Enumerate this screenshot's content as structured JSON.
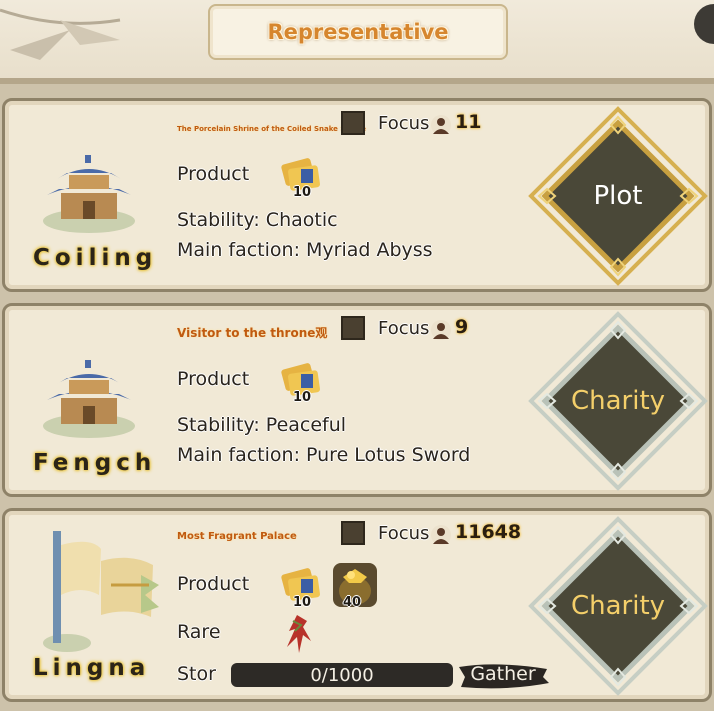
{
  "header": {
    "title": "Representative"
  },
  "cards": [
    {
      "town_name": "Coiling",
      "subtitle": "The Porcelain Shrine of the Coiled Snake Shrine",
      "focus_label": "Focus",
      "focus_value": "11",
      "product_label": "Product",
      "product_count": "10",
      "stability": "Stability: Chaotic",
      "faction": "Main faction: Myriad Abyss",
      "action_label": "Plot",
      "action_style": "gold"
    },
    {
      "town_name": "Fengch",
      "subtitle": "Visitor to the throne观",
      "focus_label": "Focus",
      "focus_value": "9",
      "product_label": "Product",
      "product_count": "10",
      "stability": "Stability: Peaceful",
      "faction": "Main faction: Pure Lotus Sword",
      "action_label": "Charity",
      "action_style": "silver"
    },
    {
      "town_name": "Lingna",
      "subtitle": "Most Fragrant  Palace",
      "focus_label": "Focus",
      "focus_value": "11648",
      "product_label": "Product",
      "product_count": "10",
      "product2_count": "40",
      "rare_label": "Rare",
      "storage_label": "Stor",
      "storage_value": "0/1000",
      "gather_label": "Gather",
      "action_label": "Charity",
      "action_style": "silver"
    }
  ],
  "colors": {
    "gold_frame": "#c8a040",
    "silver_frame": "#b9c2b8",
    "diamond_fill": "#4a4838",
    "name_glow": "#e9c540"
  },
  "icons": [
    "person-icon",
    "ticket-bundle-icon",
    "gold-sack-icon",
    "red-herb-icon",
    "pavilion-icon",
    "scroll-banner-icon"
  ]
}
